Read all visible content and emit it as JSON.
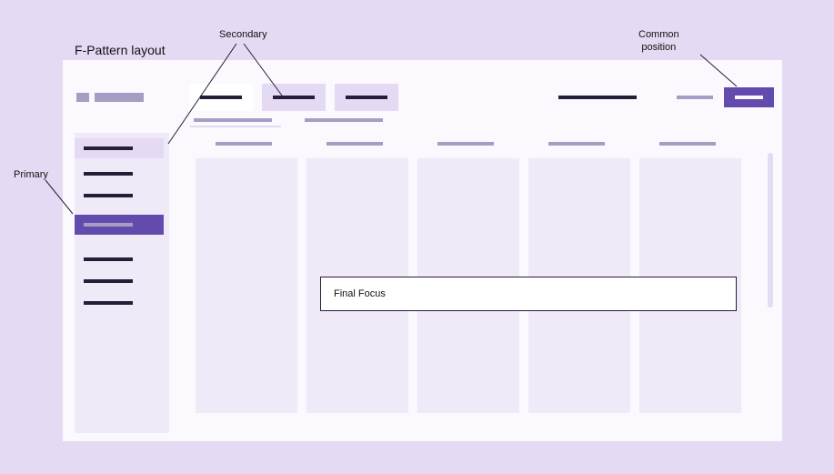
{
  "title": "F-Pattern layout",
  "annotations": {
    "secondary": "Secondary",
    "primary": "Primary",
    "common_position": "Common\nposition"
  },
  "focus_label": "Final Focus"
}
